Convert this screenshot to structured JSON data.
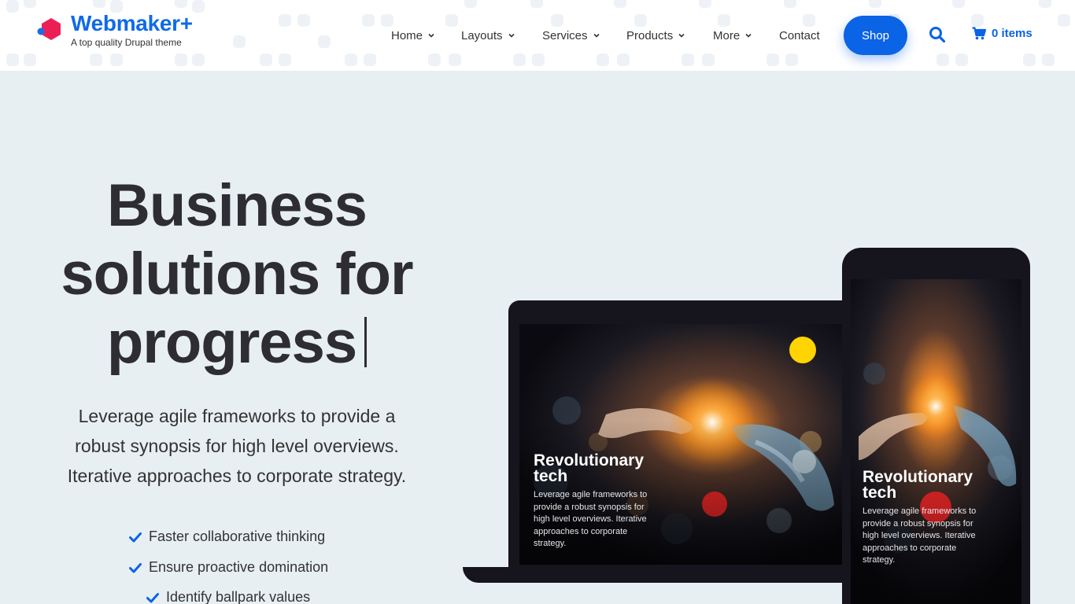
{
  "site": {
    "title": "Webmaker+",
    "tagline": "A top quality Drupal theme",
    "logo_icon": "hexagon-logo-icon",
    "brand_color": "#0f6ae8",
    "logo_color": "#ec1f55"
  },
  "nav": {
    "items": [
      {
        "label": "Home",
        "has_dropdown": true
      },
      {
        "label": "Layouts",
        "has_dropdown": true
      },
      {
        "label": "Services",
        "has_dropdown": true
      },
      {
        "label": "Products",
        "has_dropdown": true
      },
      {
        "label": "More",
        "has_dropdown": true
      },
      {
        "label": "Contact",
        "has_dropdown": false
      }
    ],
    "shop_label": "Shop",
    "search_icon": "search-icon",
    "cart_icon": "cart-icon",
    "cart_label": "0 items",
    "accent_color": "#0b63e5"
  },
  "hero": {
    "title_lines": [
      "Business",
      "solutions for",
      "progress"
    ],
    "description_lines": [
      "Leverage agile frameworks to provide a",
      "robust synopsis for high level overviews.",
      "Iterative approaches to corporate strategy."
    ],
    "features": [
      "Faster collaborative thinking",
      "Ensure proactive domination",
      "Identify ballpark values"
    ],
    "feature_icon": "check-icon",
    "background_color": "#e8eff3"
  },
  "devices": {
    "laptop": {
      "title_lines": [
        "Revolutionary",
        "tech"
      ],
      "body_lines": [
        "Leverage agile frameworks to",
        "provide a robust synopsis for",
        "high level overviews. Iterative",
        "approaches to corporate",
        "strategy."
      ]
    },
    "phone": {
      "title_lines": [
        "Revolutionary",
        "tech"
      ],
      "body_lines": [
        "Leverage agile frameworks to",
        "provide a robust synopsis for",
        "high level overviews. Iterative",
        "approaches to corporate",
        "strategy."
      ]
    }
  }
}
